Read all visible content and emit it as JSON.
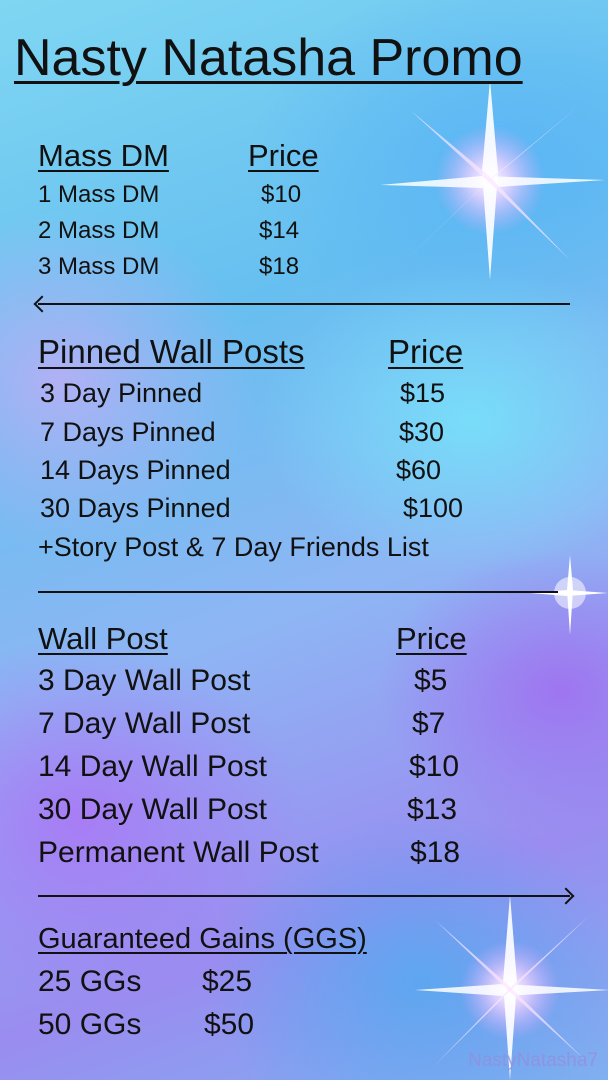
{
  "title": "Nasty Natasha Promo",
  "mass_dm": {
    "header": "Mass DM",
    "price_header": "Price",
    "rows": [
      {
        "item": "1 Mass DM",
        "price": "$10"
      },
      {
        "item": "2 Mass DM",
        "price": "$14"
      },
      {
        "item": "3 Mass DM",
        "price": "$18"
      }
    ]
  },
  "pinned": {
    "header": "Pinned Wall Posts",
    "price_header": "Price",
    "rows": [
      {
        "item": "3 Day Pinned",
        "price": "$15"
      },
      {
        "item": "7 Days Pinned",
        "price": "$30"
      },
      {
        "item": "14 Days Pinned",
        "price": "$60"
      },
      {
        "item": "30 Days Pinned",
        "price": "$100"
      }
    ],
    "note": "+Story Post & 7 Day Friends List"
  },
  "wall": {
    "header": "Wall Post",
    "price_header": "Price",
    "rows": [
      {
        "item": "3 Day Wall Post",
        "price": "$5"
      },
      {
        "item": "7 Day Wall Post",
        "price": "$7"
      },
      {
        "item": "14 Day Wall Post",
        "price": "$10"
      },
      {
        "item": "30 Day Wall Post",
        "price": "$13"
      },
      {
        "item": "Permanent Wall Post",
        "price": "$18"
      }
    ]
  },
  "gains": {
    "header": "Guaranteed Gains (GGS)",
    "rows": [
      {
        "item": "25 GGs",
        "price": "$25"
      },
      {
        "item": "50 GGs",
        "price": "$50"
      }
    ]
  },
  "watermark": "NastyNatasha7",
  "colors": {
    "text": "#111111",
    "sparkle": "#ffffff",
    "watermark": "#968cdc"
  }
}
